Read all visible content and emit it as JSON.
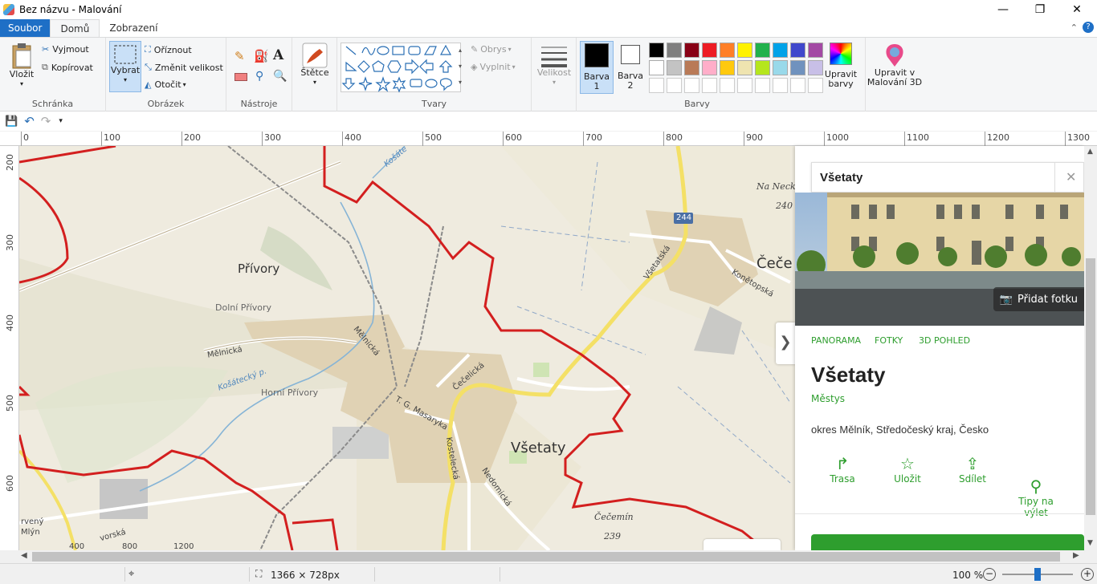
{
  "window": {
    "title": "Bez názvu - Malování",
    "minimize": "—",
    "maximize": "❐",
    "close": "✕"
  },
  "tabs": [
    {
      "label": "Soubor"
    },
    {
      "label": "Domů"
    },
    {
      "label": "Zobrazení"
    }
  ],
  "ribbon": {
    "clipboard": {
      "paste": "Vložit",
      "cut": "Vyjmout",
      "copy": "Kopírovat",
      "group": "Schránka"
    },
    "image": {
      "select": "Vybrat",
      "crop": "Oříznout",
      "resize": "Změnit velikost",
      "rotate": "Otočit",
      "group": "Obrázek"
    },
    "tools": {
      "group": "Nástroje"
    },
    "brushes": {
      "label": "Štětce"
    },
    "shapes": {
      "outline": "Obrys",
      "fill": "Vyplnit",
      "group": "Tvary"
    },
    "size": {
      "label": "Velikost"
    },
    "colors": {
      "color1": "Barva\n1",
      "color2": "Barva\n2",
      "edit": "Upravit\nbarvy",
      "group": "Barvy",
      "color1_value": "#000000",
      "color2_value": "#ffffff",
      "palette_row1": [
        "#000000",
        "#7f7f7f",
        "#880015",
        "#ed1c24",
        "#ff7f27",
        "#fff200",
        "#22b14c",
        "#00a2e8",
        "#3f48cc",
        "#a349a4"
      ],
      "palette_row2": [
        "#ffffff",
        "#c3c3c3",
        "#b97a57",
        "#ffaec9",
        "#ffc90e",
        "#efe4b0",
        "#b5e61d",
        "#99d9ea",
        "#7092be",
        "#c8bfe7"
      ]
    },
    "paint3d": {
      "label": "Upravit v\nMalování 3D"
    }
  },
  "ruler_top": [
    "0",
    "100",
    "200",
    "300",
    "400",
    "500",
    "600",
    "700",
    "800",
    "900",
    "1000",
    "1100",
    "1200",
    "1300"
  ],
  "ruler_left": [
    "200",
    "300",
    "400",
    "500",
    "600"
  ],
  "map": {
    "labels": {
      "privory": "Přívory",
      "dolni_privory": "Dolní Přívory",
      "horni_privory": "Horní Přívory",
      "vsetaty": "Všetaty",
      "cece": "Čeče",
      "na_neck": "Na Neck",
      "na_neck_alt": "240",
      "road_244": "244",
      "melnicka1": "Mělnická",
      "melnicka2": "Mělnická",
      "cecelicka": "Čečelická",
      "tg_masaryka": "T. G. Masaryka",
      "kostelecka": "Kostelecká",
      "nedomicka": "Nedomická",
      "vsetatska": "Všetatská",
      "konetopska": "Konětopská",
      "cecemin": "Čečemín",
      "cecemin_alt": "239",
      "kosatecky": "Košátecký p.",
      "kosate": "Košáte",
      "cerveny_mlyn": "rvený\nMlýn",
      "vorska": "vorská",
      "scale_400": "400",
      "scale_800": "800",
      "scale_1200": "1200"
    }
  },
  "panel": {
    "search_value": "Všetaty",
    "add_photo": "Přidat fotku",
    "links": [
      "PANORAMA",
      "FOTKY",
      "3D POHLED"
    ],
    "place_name": "Všetaty",
    "place_type": "Městys",
    "place_region": "okres Mělník, Středočeský kraj, Česko",
    "actions": [
      {
        "label": "Trasa"
      },
      {
        "label": "Uložit"
      },
      {
        "label": "Sdílet"
      },
      {
        "label": "Tipy na\nvýlet"
      }
    ]
  },
  "status": {
    "dimensions": "1366 × 728px",
    "zoom": "100 %",
    "zoom_fraction": 0.5
  }
}
